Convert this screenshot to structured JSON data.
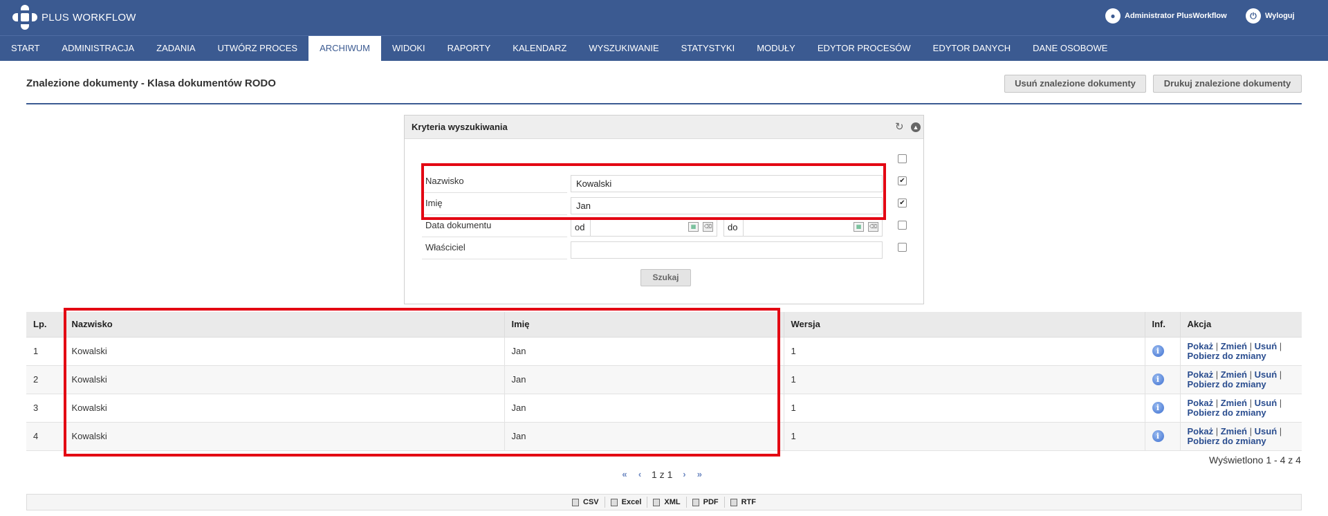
{
  "app": {
    "logo_part1": "PLUS",
    "logo_part2": "WORKFLOW",
    "user_name": "Administrator PlusWorkflow",
    "logout_label": "Wyloguj"
  },
  "menu": [
    {
      "label": "START",
      "active": false
    },
    {
      "label": "ADMINISTRACJA",
      "active": false
    },
    {
      "label": "ZADANIA",
      "active": false
    },
    {
      "label": "UTWÓRZ PROCES",
      "active": false
    },
    {
      "label": "ARCHIWUM",
      "active": true
    },
    {
      "label": "WIDOKI",
      "active": false
    },
    {
      "label": "RAPORTY",
      "active": false
    },
    {
      "label": "KALENDARZ",
      "active": false
    },
    {
      "label": "WYSZUKIWANIE",
      "active": false
    },
    {
      "label": "STATYSTYKI",
      "active": false
    },
    {
      "label": "MODUŁY",
      "active": false
    },
    {
      "label": "EDYTOR PROCESÓW",
      "active": false
    },
    {
      "label": "EDYTOR DANYCH",
      "active": false
    },
    {
      "label": "DANE OSOBOWE",
      "active": false
    }
  ],
  "page": {
    "title": "Znalezione dokumenty - Klasa dokumentów RODO",
    "delete_button": "Usuń znalezione dokumenty",
    "print_button": "Drukuj znalezione dokumenty"
  },
  "criteria": {
    "title": "Kryteria wyszukiwania",
    "refresh_icon": "refresh-icon",
    "collapse_icon": "collapse-icon",
    "select_all_checked": false,
    "fields": [
      {
        "label": "Nazwisko",
        "value": "Kowalski",
        "checked": true
      },
      {
        "label": "Imię",
        "value": "Jan",
        "checked": true
      },
      {
        "label": "Data dokumentu",
        "from_label": "od",
        "to_label": "do",
        "from_value": "",
        "to_value": "",
        "checked": false
      },
      {
        "label": "Właściciel",
        "value": "",
        "checked": false
      }
    ],
    "search_button": "Szukaj"
  },
  "table": {
    "columns": [
      "Lp.",
      "Nazwisko",
      "Imię",
      "Wersja",
      "Inf.",
      "Akcja"
    ],
    "rows": [
      {
        "lp": "1",
        "nazwisko": "Kowalski",
        "imie": "Jan",
        "wersja": "1"
      },
      {
        "lp": "2",
        "nazwisko": "Kowalski",
        "imie": "Jan",
        "wersja": "1"
      },
      {
        "lp": "3",
        "nazwisko": "Kowalski",
        "imie": "Jan",
        "wersja": "1"
      },
      {
        "lp": "4",
        "nazwisko": "Kowalski",
        "imie": "Jan",
        "wersja": "1"
      }
    ],
    "actions": {
      "show": "Pokaż",
      "edit": "Zmień",
      "delete": "Usuń",
      "checkout": "Pobierz do zmiany",
      "separator": "|"
    },
    "info_glyph": "i"
  },
  "pager": {
    "first": "«",
    "prev": "‹",
    "info": "1 z 1",
    "next": "›",
    "last": "»",
    "summary": "Wyświetlono 1 - 4 z 4"
  },
  "export": [
    "CSV",
    "Excel",
    "XML",
    "PDF",
    "RTF"
  ],
  "colors": {
    "header_bg": "#3b5a91",
    "highlight": "#e30613",
    "link": "#2a4d8f"
  }
}
